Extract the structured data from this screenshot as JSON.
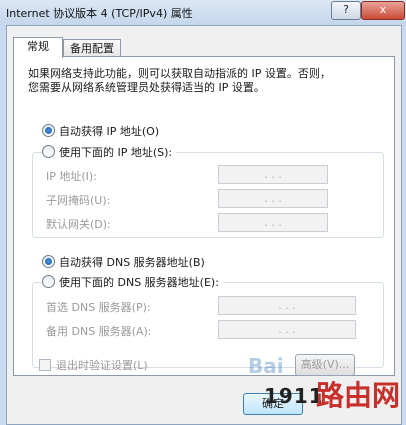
{
  "window": {
    "title": "Internet 协议版本 4 (TCP/IPv4) 属性",
    "help_label": "?",
    "close_label": "x"
  },
  "tabs": [
    {
      "label": "常规"
    },
    {
      "label": "备用配置"
    }
  ],
  "description": "如果网络支持此功能，则可以获取自动指派的 IP 设置。否则，\n您需要从网络系统管理员处获得适当的 IP 设置。",
  "ip_section": {
    "auto_label": "自动获得 IP 地址(O)",
    "manual_label": "使用下面的 IP 地址(S):",
    "fields": [
      {
        "label": "IP 地址(I):",
        "value": ".   .   ."
      },
      {
        "label": "子网掩码(U):",
        "value": ".   .   ."
      },
      {
        "label": "默认网关(D):",
        "value": ".   .   ."
      }
    ]
  },
  "dns_section": {
    "auto_label": "自动获得 DNS 服务器地址(B)",
    "manual_label": "使用下面的 DNS 服务器地址(E):",
    "fields": [
      {
        "label": "首选 DNS 服务器(P):",
        "value": ".   .   ."
      },
      {
        "label": "备用 DNS 服务器(A):",
        "value": ".   .   ."
      }
    ]
  },
  "validate_label": "退出时验证设置(L)",
  "advanced_label": "高级(V)...",
  "ok_label": "确定",
  "watermark": {
    "number": "1911",
    "text": "路由网",
    "baidu": "Bai"
  }
}
